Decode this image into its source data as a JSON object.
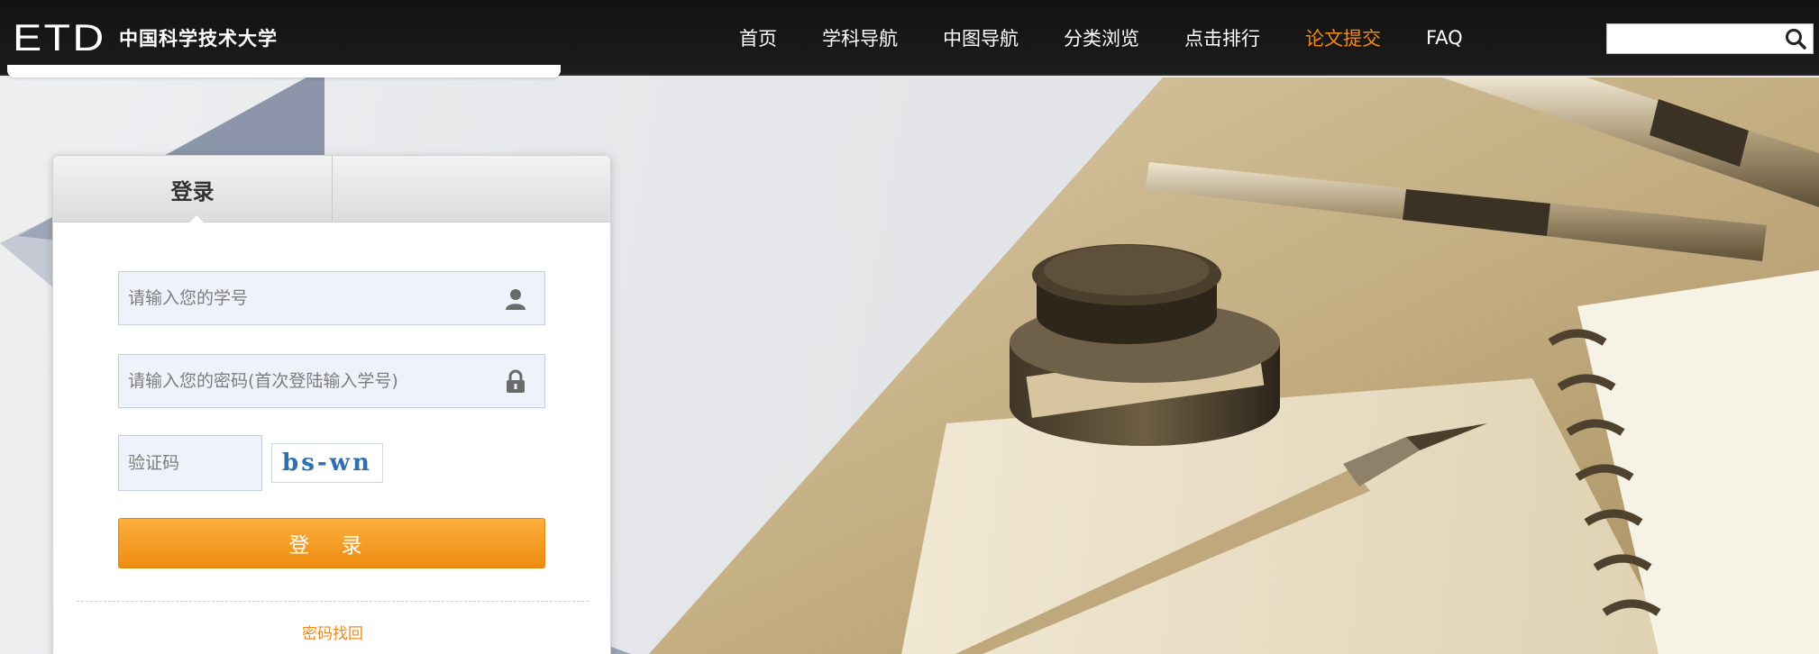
{
  "brand": {
    "logo": "ETD",
    "name": "中国科学技术大学"
  },
  "nav": {
    "items": [
      {
        "label": "首页",
        "active": false
      },
      {
        "label": "学科导航",
        "active": false
      },
      {
        "label": "中图导航",
        "active": false
      },
      {
        "label": "分类浏览",
        "active": false
      },
      {
        "label": "点击排行",
        "active": false
      },
      {
        "label": "论文提交",
        "active": true
      },
      {
        "label": "FAQ",
        "active": false
      }
    ],
    "search": {
      "value": "",
      "icon": "search-icon"
    }
  },
  "login": {
    "tab_label": "登录",
    "username_placeholder": "请输入您的学号",
    "password_placeholder": "请输入您的密码(首次登陆输入学号)",
    "captcha_placeholder": "验证码",
    "captcha_text": "bs-wn",
    "submit_label": "登 录",
    "forgot_label": "密码找回"
  },
  "colors": {
    "accent": "#ef8c12",
    "nav_bg": "#161616",
    "active_nav": "#f08a1c"
  }
}
